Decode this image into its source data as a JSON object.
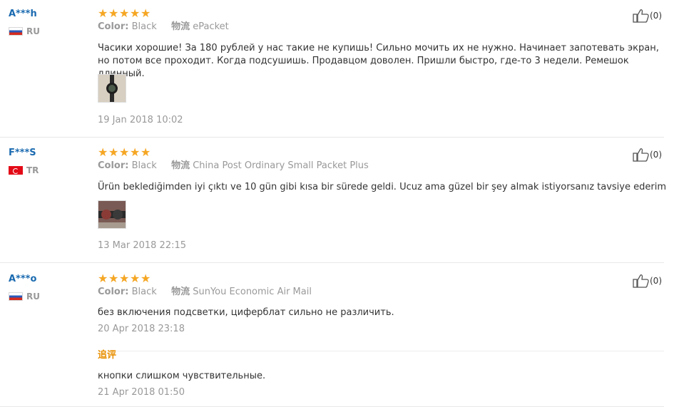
{
  "reviews": [
    {
      "user": "A***h",
      "country": "RU",
      "flag": "russia",
      "rating": 5,
      "color_label": "Color:",
      "color_value": "Black",
      "shipping_label": "物流",
      "shipping_value": "ePacket",
      "text": "Часики хорошие! За 180 рублей у нас такие не купишь! Сильно мочить их не нужно. Начинает запотевать экран, но потом все проходит. Когда подсушишь. Продавцом доволен. Пришли быстро, где-то 3 недели. Ремешок длинный.",
      "has_photo": true,
      "date": "19 Jan 2018 10:02",
      "helpful_count": "(0)"
    },
    {
      "user": "F***S",
      "country": "TR",
      "flag": "turkey",
      "rating": 5,
      "color_label": "Color:",
      "color_value": "Black",
      "shipping_label": "物流",
      "shipping_value": "China Post Ordinary Small Packet Plus",
      "text": "Ürün beklediğimden iyi çıktı ve 10 gün gibi kısa bir sürede geldi. Ucuz ama güzel bir şey almak istiyorsanız tavsiye ederim",
      "has_photo": true,
      "date": "13 Mar 2018 22:15",
      "helpful_count": "(0)"
    },
    {
      "user": "A***o",
      "country": "RU",
      "flag": "russia",
      "rating": 5,
      "color_label": "Color:",
      "color_value": "Black",
      "shipping_label": "物流",
      "shipping_value": "SunYou Economic Air Mail",
      "text": "без включения подсветки, циферблат сильно не различить.",
      "has_photo": false,
      "date": "20 Apr 2018 23:18",
      "helpful_count": "(0)",
      "additional": {
        "label": "追评",
        "text": "кнопки слишком чувствительные.",
        "date": "21 Apr 2018 01:50"
      }
    }
  ],
  "icons": {
    "star": "star-icon",
    "thumbs_up": "thumbs-up-icon"
  },
  "colors": {
    "username": "#1a6ab0",
    "star": "#f5a623",
    "muted": "#999999",
    "additional_label": "#e88f00"
  }
}
